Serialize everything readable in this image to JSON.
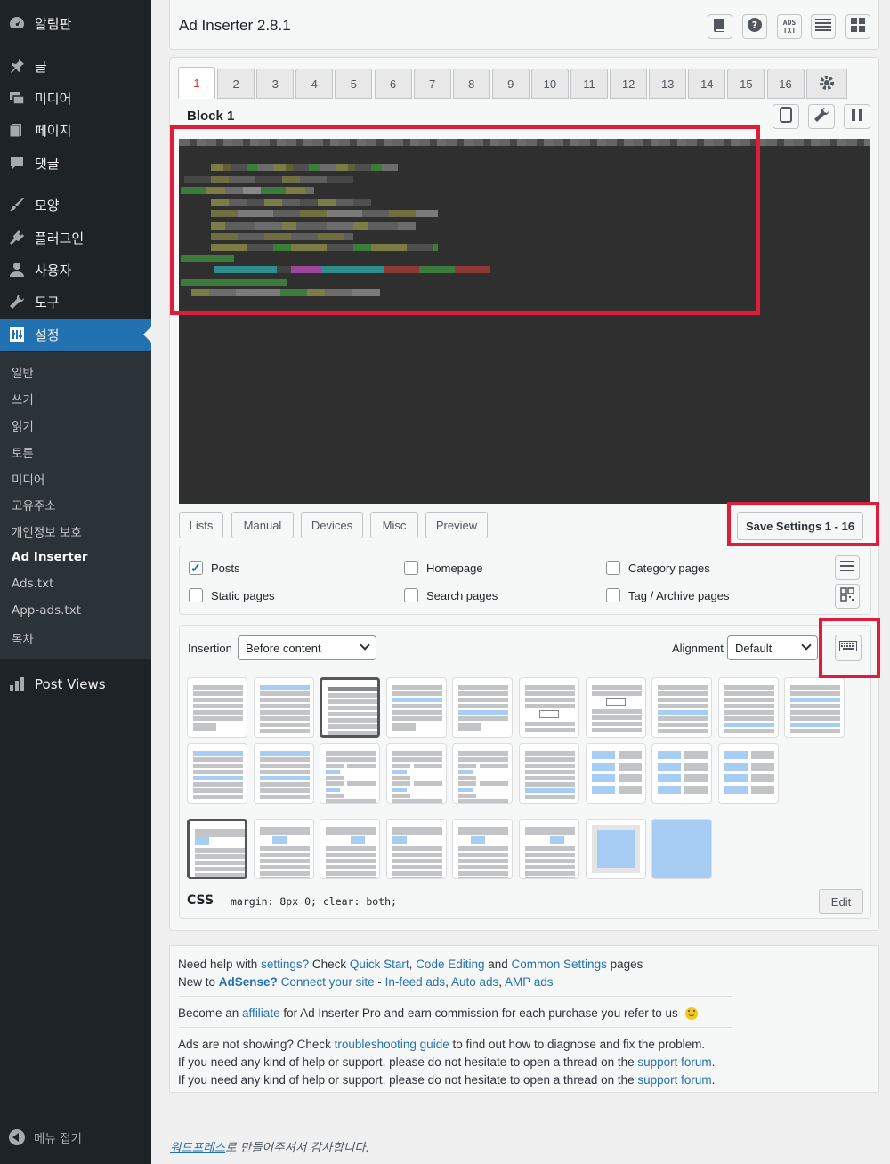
{
  "sidebar": {
    "items": [
      {
        "label": "알림판",
        "icon": "dashboard-icon"
      },
      {
        "label": "글",
        "icon": "pin-icon"
      },
      {
        "label": "미디어",
        "icon": "media-icon"
      },
      {
        "label": "페이지",
        "icon": "page-icon"
      },
      {
        "label": "댓글",
        "icon": "comment-icon"
      },
      {
        "label": "모양",
        "icon": "brush-icon"
      },
      {
        "label": "플러그인",
        "icon": "plugin-icon"
      },
      {
        "label": "사용자",
        "icon": "user-icon"
      },
      {
        "label": "도구",
        "icon": "wrench-icon"
      },
      {
        "label": "설정",
        "icon": "settings-icon"
      },
      {
        "label": "Post Views",
        "icon": "bar-chart-icon"
      }
    ],
    "submenu": [
      "일반",
      "쓰기",
      "읽기",
      "토론",
      "미디어",
      "고유주소",
      "개인정보 보호",
      "Ad Inserter",
      "Ads.txt",
      "App-ads.txt",
      "목차"
    ],
    "collapse_label": "메뉴 접기"
  },
  "header": {
    "title": "Ad Inserter 2.8.1",
    "ads_icon_text": "ADS TXT"
  },
  "tabs": [
    "1",
    "2",
    "3",
    "4",
    "5",
    "6",
    "7",
    "8",
    "9",
    "10",
    "11",
    "12",
    "13",
    "14",
    "15",
    "16"
  ],
  "block": {
    "title": "Block 1"
  },
  "buttons": {
    "lists": "Lists",
    "manual": "Manual",
    "devices": "Devices",
    "misc": "Misc",
    "preview": "Preview",
    "save": "Save Settings 1 - 16",
    "edit": "Edit"
  },
  "checkboxes": {
    "posts": "Posts",
    "static_pages": "Static pages",
    "homepage": "Homepage",
    "search_pages": "Search pages",
    "category_pages": "Category pages",
    "tag_archive_pages": "Tag / Archive pages"
  },
  "insertion": {
    "label": "Insertion",
    "value": "Before content"
  },
  "alignment": {
    "label": "Alignment",
    "value": "Default"
  },
  "css": {
    "label": "CSS",
    "value": "margin: 8px 0; clear: both;"
  },
  "help": {
    "l1a": "Need help with ",
    "l1b": "settings?",
    "l1c": " Check ",
    "l1d": "Quick Start",
    "l1e": ", ",
    "l1f": "Code Editing",
    "l1g": " and ",
    "l1h": "Common Settings",
    "l1i": " pages",
    "l2a": "New to ",
    "l2b": "AdSense?",
    "l2c": " ",
    "l2d": "Connect your site",
    "l2e": " - ",
    "l2f": "In-feed ads",
    "l2g": ", ",
    "l2h": "Auto ads",
    "l2i": ", ",
    "l2j": "AMP ads",
    "l3a": "Become an ",
    "l3b": "affiliate",
    "l3c": " for Ad Inserter Pro and earn commission for each purchase you refer to us",
    "l4a": "Ads are not showing? Check ",
    "l4b": "troubleshooting guide",
    "l4c": " to find out how to diagnose and fix the problem.",
    "l5a": "If you need any kind of help or support, please do not hesitate to open a thread on the ",
    "l5b": "support forum",
    "l5c": "."
  },
  "footer": {
    "link": "워드프레스",
    "text": "로 만들어주셔서 감사합니다."
  },
  "colors": {
    "sidebar_bg": "#1d2327",
    "active": "#2271b1",
    "highlight": "#e01b3c",
    "link": "#2271b1"
  }
}
